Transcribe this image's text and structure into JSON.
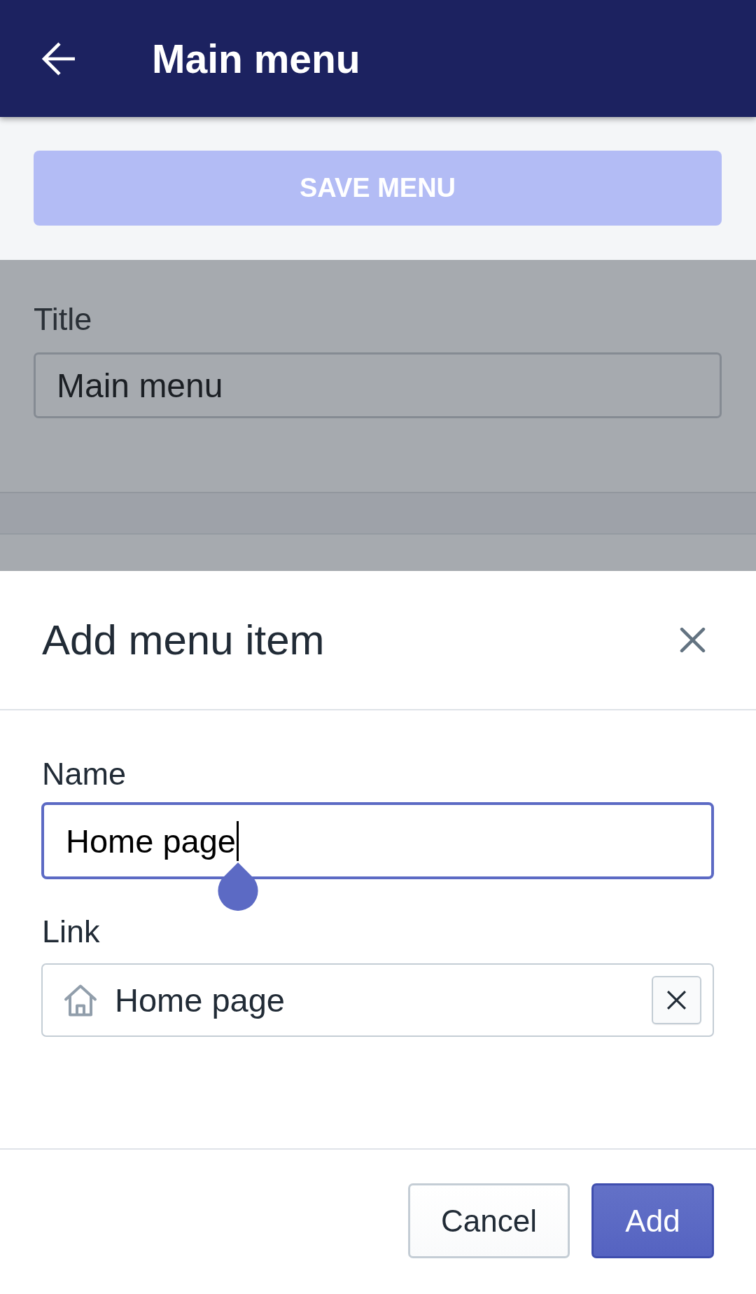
{
  "app_bar": {
    "title": "Main menu"
  },
  "save_button": {
    "label": "SAVE MENU",
    "disabled": true
  },
  "title_field": {
    "label": "Title",
    "value": "Main menu"
  },
  "dialog": {
    "title": "Add menu item",
    "name_field": {
      "label": "Name",
      "value": "Home page",
      "focused": true
    },
    "link_field": {
      "label": "Link",
      "value": "Home page"
    },
    "buttons": [
      {
        "label": "Cancel",
        "kind": "secondary"
      },
      {
        "label": "Add",
        "kind": "primary"
      }
    ]
  }
}
